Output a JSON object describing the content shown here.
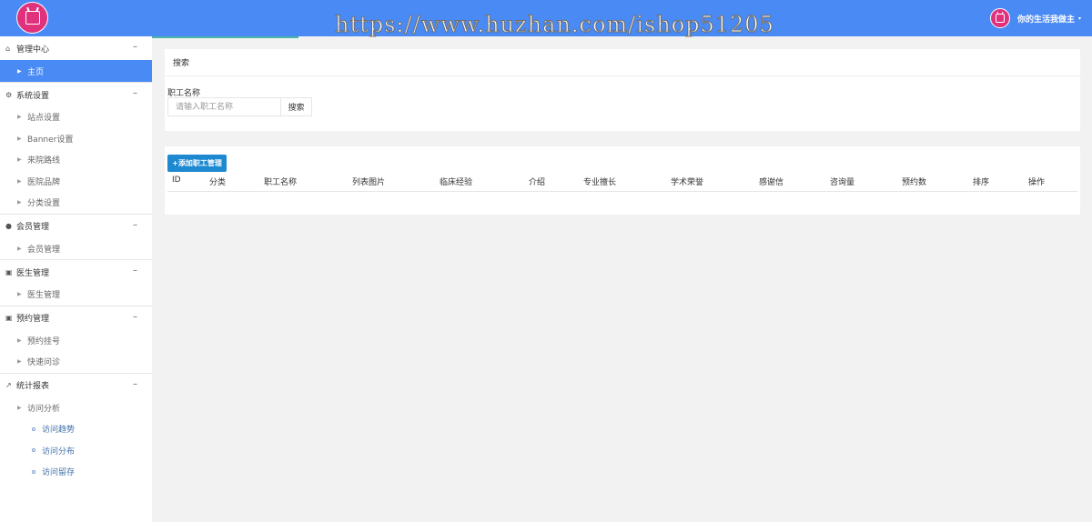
{
  "header": {
    "watermark": "https://www.huzhan.com/ishop51205",
    "user_name": "你的生活我做主",
    "user_caret": "▾"
  },
  "sidebar": {
    "groups": [
      {
        "label": "管理中心",
        "icon": "home-icon",
        "items": [
          {
            "label": "主页",
            "active": true
          }
        ]
      },
      {
        "label": "系统设置",
        "icon": "gear-icon",
        "items": [
          {
            "label": "站点设置"
          },
          {
            "label": "Banner设置"
          },
          {
            "label": "来院路线"
          },
          {
            "label": "医院品牌"
          },
          {
            "label": "分类设置"
          }
        ]
      },
      {
        "label": "会员管理",
        "icon": "user-icon",
        "items": [
          {
            "label": "会员管理"
          }
        ]
      },
      {
        "label": "医生管理",
        "icon": "archive-icon",
        "items": [
          {
            "label": "医生管理"
          }
        ]
      },
      {
        "label": "预约管理",
        "icon": "archive-icon",
        "items": [
          {
            "label": "预约挂号"
          },
          {
            "label": "快速问诊"
          }
        ]
      },
      {
        "label": "统计报表",
        "icon": "chart-line-icon",
        "items": [
          {
            "label": "访问分析",
            "children": [
              {
                "label": "访问趋势"
              },
              {
                "label": "访问分布"
              },
              {
                "label": "访问留存"
              }
            ]
          }
        ]
      }
    ],
    "collapse_symbol": "–"
  },
  "search_panel": {
    "title": "搜索",
    "field_label": "职工名称",
    "input_placeholder": "请输入职工名称",
    "input_value": "",
    "button_label": "搜索"
  },
  "table_panel": {
    "add_button_label": "+添加职工管理",
    "columns": [
      "ID",
      "分类",
      "职工名称",
      "列表图片",
      "临床经验",
      "介绍",
      "专业擅长",
      "学术荣誉",
      "感谢信",
      "咨询量",
      "预约数",
      "排序",
      "操作"
    ],
    "rows": []
  },
  "colors": {
    "topbar": "#4a8af4",
    "active_item": "#4a8af4",
    "add_button": "#1e88d0",
    "logo": "#e0317c"
  }
}
